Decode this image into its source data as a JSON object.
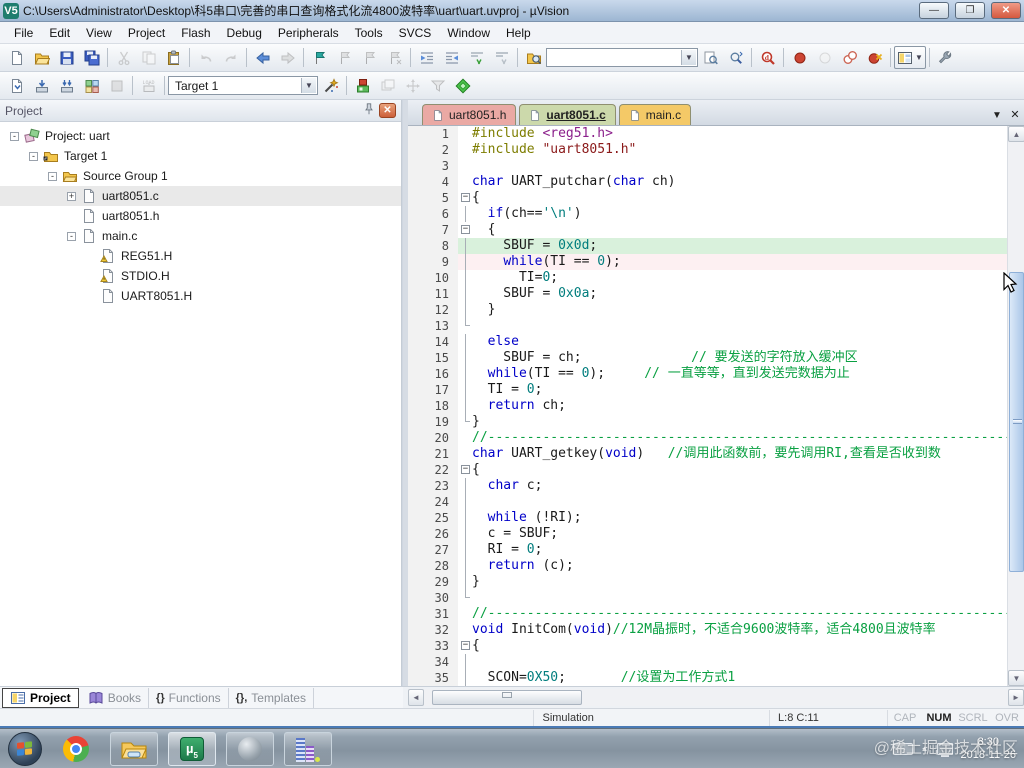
{
  "window": {
    "title": "C:\\Users\\Administrator\\Desktop\\科5串口\\完善的串口查询格式化流4800波特率\\uart\\uart.uvproj - µVision",
    "app_badge": "V5",
    "controls": {
      "minimize": "—",
      "restore": "❐",
      "close": "✕"
    }
  },
  "menu": {
    "items": [
      "File",
      "Edit",
      "View",
      "Project",
      "Flash",
      "Debug",
      "Peripherals",
      "Tools",
      "SVCS",
      "Window",
      "Help"
    ]
  },
  "toolbar1": {
    "items": [
      {
        "icon": "new-file-icon"
      },
      {
        "icon": "open-file-icon"
      },
      {
        "icon": "save-icon"
      },
      {
        "icon": "save-all-icon"
      },
      {
        "sep": true
      },
      {
        "icon": "cut-icon",
        "disabled": true
      },
      {
        "icon": "copy-icon",
        "disabled": true
      },
      {
        "icon": "paste-icon"
      },
      {
        "sep": true
      },
      {
        "icon": "undo-icon",
        "disabled": true
      },
      {
        "icon": "redo-icon",
        "disabled": true
      },
      {
        "sep": true
      },
      {
        "icon": "navigate-back-icon"
      },
      {
        "icon": "navigate-forward-icon",
        "disabled": true
      },
      {
        "sep": true
      },
      {
        "icon": "bookmark-toggle-icon"
      },
      {
        "icon": "bookmark-prev-icon",
        "disabled": true
      },
      {
        "icon": "bookmark-next-icon",
        "disabled": true
      },
      {
        "icon": "bookmark-clear-icon",
        "disabled": true
      },
      {
        "sep": true
      },
      {
        "icon": "indent-right-icon"
      },
      {
        "icon": "indent-left-icon"
      },
      {
        "icon": "comment-icon"
      },
      {
        "icon": "uncomment-icon"
      },
      {
        "sep": true
      },
      {
        "icon": "find-in-files-icon"
      },
      {
        "combo": "search",
        "width": 152
      },
      {
        "icon": "find-next-icon"
      },
      {
        "icon": "incremental-find-icon"
      },
      {
        "sep": true
      },
      {
        "icon": "debug-session-icon"
      },
      {
        "sep": true
      },
      {
        "icon": "breakpoint-insert-icon"
      },
      {
        "icon": "breakpoint-enable-icon",
        "disabled": true
      },
      {
        "icon": "breakpoint-disable-all-icon"
      },
      {
        "icon": "breakpoint-kill-all-icon"
      },
      {
        "sep": true
      },
      {
        "winlayout": true
      },
      {
        "sep": true
      },
      {
        "icon": "configure-wrench-icon"
      }
    ],
    "search_value": ""
  },
  "toolbar2": {
    "items": [
      {
        "icon": "translate-icon"
      },
      {
        "icon": "build-icon"
      },
      {
        "icon": "rebuild-icon"
      },
      {
        "icon": "batch-build-icon"
      },
      {
        "icon": "stop-build-icon",
        "disabled": true
      },
      {
        "sep": true
      },
      {
        "icon": "download-load-icon",
        "disabled": true
      },
      {
        "sep": true
      },
      {
        "combo": "target",
        "width": 150
      },
      {
        "icon": "options-wand-icon"
      },
      {
        "sep": true
      },
      {
        "icon": "debug-cube-icon"
      },
      {
        "icon": "window-stack-icon",
        "disabled": true
      },
      {
        "icon": "move-icon",
        "disabled": true
      },
      {
        "icon": "funnel-icon",
        "disabled": true
      },
      {
        "icon": "pack-installer-icon"
      }
    ],
    "target_value": "Target 1"
  },
  "project_panel": {
    "title": "Project",
    "tree": [
      {
        "label": "Project: uart",
        "level": 0,
        "expand": "-",
        "icon": "project-icon",
        "selected": false
      },
      {
        "label": "Target 1",
        "level": 1,
        "expand": "-",
        "icon": "target-folder-icon",
        "selected": false
      },
      {
        "label": "Source Group 1",
        "level": 2,
        "expand": "-",
        "icon": "folder-icon",
        "selected": false
      },
      {
        "label": "uart8051.c",
        "level": 3,
        "expand": "+",
        "icon": "file-icon",
        "selected": true
      },
      {
        "label": "uart8051.h",
        "level": 3,
        "expand": "",
        "icon": "file-icon",
        "selected": false
      },
      {
        "label": "main.c",
        "level": 3,
        "expand": "-",
        "icon": "file-icon",
        "selected": false
      },
      {
        "label": "REG51.H",
        "level": 4,
        "expand": "",
        "icon": "file-warning-icon",
        "selected": false
      },
      {
        "label": "STDIO.H",
        "level": 4,
        "expand": "",
        "icon": "file-warning-icon",
        "selected": false
      },
      {
        "label": "UART8051.H",
        "level": 4,
        "expand": "",
        "icon": "file-icon",
        "selected": false
      }
    ]
  },
  "editor": {
    "tabs": [
      {
        "label": "uart8051.h",
        "color": "#eaa9a4",
        "active": false
      },
      {
        "label": "uart8051.c",
        "color": "#ccd9ab",
        "active": true
      },
      {
        "label": "main.c",
        "color": "#f4c967",
        "active": false
      }
    ],
    "lines": [
      {
        "n": 1,
        "fold": "",
        "hl": "",
        "segs": [
          [
            "#include ",
            "pp"
          ],
          [
            "<reg51.h>",
            "inc"
          ]
        ]
      },
      {
        "n": 2,
        "fold": "",
        "hl": "",
        "segs": [
          [
            "#include ",
            "pp"
          ],
          [
            "\"uart8051.h\"",
            "str"
          ]
        ]
      },
      {
        "n": 3,
        "fold": "",
        "hl": "",
        "segs": []
      },
      {
        "n": 4,
        "fold": "",
        "hl": "",
        "segs": [
          [
            "char",
            "kw"
          ],
          [
            " UART_putchar(",
            "pl"
          ],
          [
            "char",
            "kw"
          ],
          [
            " ch)",
            "pl"
          ]
        ]
      },
      {
        "n": 5,
        "fold": "box",
        "hl": "",
        "segs": [
          [
            "{",
            "pl"
          ]
        ]
      },
      {
        "n": 6,
        "fold": "line",
        "hl": "",
        "segs": [
          [
            "  ",
            "pl"
          ],
          [
            "if",
            "kw"
          ],
          [
            "(ch==",
            "pl"
          ],
          [
            "'\\n'",
            "num"
          ],
          [
            ")",
            "pl"
          ]
        ]
      },
      {
        "n": 7,
        "fold": "box",
        "hl": "",
        "segs": [
          [
            "  {",
            "pl"
          ]
        ]
      },
      {
        "n": 8,
        "fold": "line",
        "hl": "green",
        "segs": [
          [
            "    SBUF = ",
            "pl"
          ],
          [
            "0x0d",
            "num"
          ],
          [
            ";",
            "pl"
          ]
        ]
      },
      {
        "n": 9,
        "fold": "line",
        "hl": "pink",
        "segs": [
          [
            "    ",
            "pl"
          ],
          [
            "while",
            "kw"
          ],
          [
            "(TI == ",
            "pl"
          ],
          [
            "0",
            "num"
          ],
          [
            ");",
            "pl"
          ]
        ]
      },
      {
        "n": 10,
        "fold": "line",
        "hl": "",
        "segs": [
          [
            "      TI=",
            "pl"
          ],
          [
            "0",
            "num"
          ],
          [
            ";",
            "pl"
          ]
        ]
      },
      {
        "n": 11,
        "fold": "line",
        "hl": "",
        "segs": [
          [
            "    SBUF = ",
            "pl"
          ],
          [
            "0x0a",
            "num"
          ],
          [
            ";",
            "pl"
          ]
        ]
      },
      {
        "n": 12,
        "fold": "line",
        "hl": "",
        "segs": [
          [
            "  }",
            "pl"
          ]
        ]
      },
      {
        "n": 13,
        "fold": "end",
        "hl": "",
        "segs": []
      },
      {
        "n": 14,
        "fold": "line",
        "hl": "",
        "segs": [
          [
            "  ",
            "pl"
          ],
          [
            "else",
            "kw"
          ]
        ]
      },
      {
        "n": 15,
        "fold": "line",
        "hl": "",
        "segs": [
          [
            "    SBUF = ch;",
            "pl"
          ],
          [
            "              ",
            "pl"
          ],
          [
            "// 要发送的字符放入缓冲区",
            "com"
          ]
        ]
      },
      {
        "n": 16,
        "fold": "line",
        "hl": "",
        "segs": [
          [
            "  ",
            "pl"
          ],
          [
            "while",
            "kw"
          ],
          [
            "(TI == ",
            "pl"
          ],
          [
            "0",
            "num"
          ],
          [
            ");     ",
            "pl"
          ],
          [
            "// 一直等等，直到发送完数据为止",
            "com"
          ]
        ]
      },
      {
        "n": 17,
        "fold": "line",
        "hl": "",
        "segs": [
          [
            "  TI = ",
            "pl"
          ],
          [
            "0",
            "num"
          ],
          [
            ";",
            "pl"
          ]
        ]
      },
      {
        "n": 18,
        "fold": "line",
        "hl": "",
        "segs": [
          [
            "  ",
            "pl"
          ],
          [
            "return",
            "kw"
          ],
          [
            " ch;",
            "pl"
          ]
        ]
      },
      {
        "n": 19,
        "fold": "end",
        "hl": "",
        "segs": [
          [
            "}",
            "pl"
          ]
        ]
      },
      {
        "n": 20,
        "fold": "",
        "hl": "",
        "segs": [
          [
            "//------------------------------------------------------------------------------------------",
            "com"
          ]
        ]
      },
      {
        "n": 21,
        "fold": "",
        "hl": "",
        "segs": [
          [
            "char",
            "kw"
          ],
          [
            " UART_getkey(",
            "pl"
          ],
          [
            "void",
            "kw"
          ],
          [
            ")   ",
            "pl"
          ],
          [
            "//调用此函数前，要先调用RI,查看是否收到数",
            "com"
          ]
        ]
      },
      {
        "n": 22,
        "fold": "box",
        "hl": "",
        "segs": [
          [
            "{",
            "pl"
          ]
        ]
      },
      {
        "n": 23,
        "fold": "line",
        "hl": "",
        "segs": [
          [
            "  ",
            "pl"
          ],
          [
            "char",
            "kw"
          ],
          [
            " c;",
            "pl"
          ]
        ]
      },
      {
        "n": 24,
        "fold": "line",
        "hl": "",
        "segs": []
      },
      {
        "n": 25,
        "fold": "line",
        "hl": "",
        "segs": [
          [
            "  ",
            "pl"
          ],
          [
            "while",
            "kw"
          ],
          [
            " (!RI);",
            "pl"
          ]
        ]
      },
      {
        "n": 26,
        "fold": "line",
        "hl": "",
        "segs": [
          [
            "  c = SBUF;",
            "pl"
          ]
        ]
      },
      {
        "n": 27,
        "fold": "line",
        "hl": "",
        "segs": [
          [
            "  RI = ",
            "pl"
          ],
          [
            "0",
            "num"
          ],
          [
            ";",
            "pl"
          ]
        ]
      },
      {
        "n": 28,
        "fold": "line",
        "hl": "",
        "segs": [
          [
            "  ",
            "pl"
          ],
          [
            "return",
            "kw"
          ],
          [
            " (c);",
            "pl"
          ]
        ]
      },
      {
        "n": 29,
        "fold": "line",
        "hl": "",
        "segs": [
          [
            "}",
            "pl"
          ]
        ]
      },
      {
        "n": 30,
        "fold": "end",
        "hl": "",
        "segs": []
      },
      {
        "n": 31,
        "fold": "",
        "hl": "",
        "segs": [
          [
            "//------------------------------------------------------------------------------------------",
            "com"
          ]
        ]
      },
      {
        "n": 32,
        "fold": "",
        "hl": "",
        "segs": [
          [
            "void",
            "kw"
          ],
          [
            " InitCom(",
            "pl"
          ],
          [
            "void",
            "kw"
          ],
          [
            ")",
            "pl"
          ],
          [
            "//12M晶振时，不适合9600波特率，适合4800且波特率",
            "com"
          ]
        ]
      },
      {
        "n": 33,
        "fold": "box",
        "hl": "",
        "segs": [
          [
            "{",
            "pl"
          ]
        ]
      },
      {
        "n": 34,
        "fold": "line",
        "hl": "",
        "segs": []
      },
      {
        "n": 35,
        "fold": "line",
        "hl": "",
        "segs": [
          [
            "  SCON=",
            "pl"
          ],
          [
            "0X50",
            "num"
          ],
          [
            ";       ",
            "pl"
          ],
          [
            "//设置为工作方式1",
            "com"
          ]
        ]
      }
    ]
  },
  "view_tabs": [
    {
      "label": "Project",
      "glyph": "icon",
      "active": true
    },
    {
      "label": "Books",
      "glyph": "book",
      "active": false
    },
    {
      "label": "Functions",
      "glyph": "{}",
      "active": false
    },
    {
      "label": "Templates",
      "glyph": "{},",
      "active": false
    }
  ],
  "statusbar": {
    "mode": "Simulation",
    "position": "L:8 C:11",
    "indicators": [
      {
        "label": "CAP",
        "active": false
      },
      {
        "label": "NUM",
        "active": true
      },
      {
        "label": "SCRL",
        "active": false
      },
      {
        "label": "OVR",
        "active": false
      }
    ]
  },
  "taskbar": {
    "apps": [
      "start-orb",
      "chrome-icon",
      "explorer-icon",
      "uvision-icon",
      "globe-app-icon",
      "buildings-app-icon"
    ],
    "clock_time": "8:30",
    "clock_date": "2018-11-26",
    "watermark": "@稀土掘金技术社区"
  },
  "colors": {
    "keyword": "#0000c8",
    "number": "#007d7d",
    "comment": "#0aa042",
    "preprocessor": "#7d7d00",
    "include": "#8b1f8b",
    "string": "#8b1a1a",
    "line_highlight": "#d9f1dc",
    "tab_h": "#eaa9a4",
    "tab_c": "#ccd9ab",
    "tab_main": "#f4c967"
  }
}
